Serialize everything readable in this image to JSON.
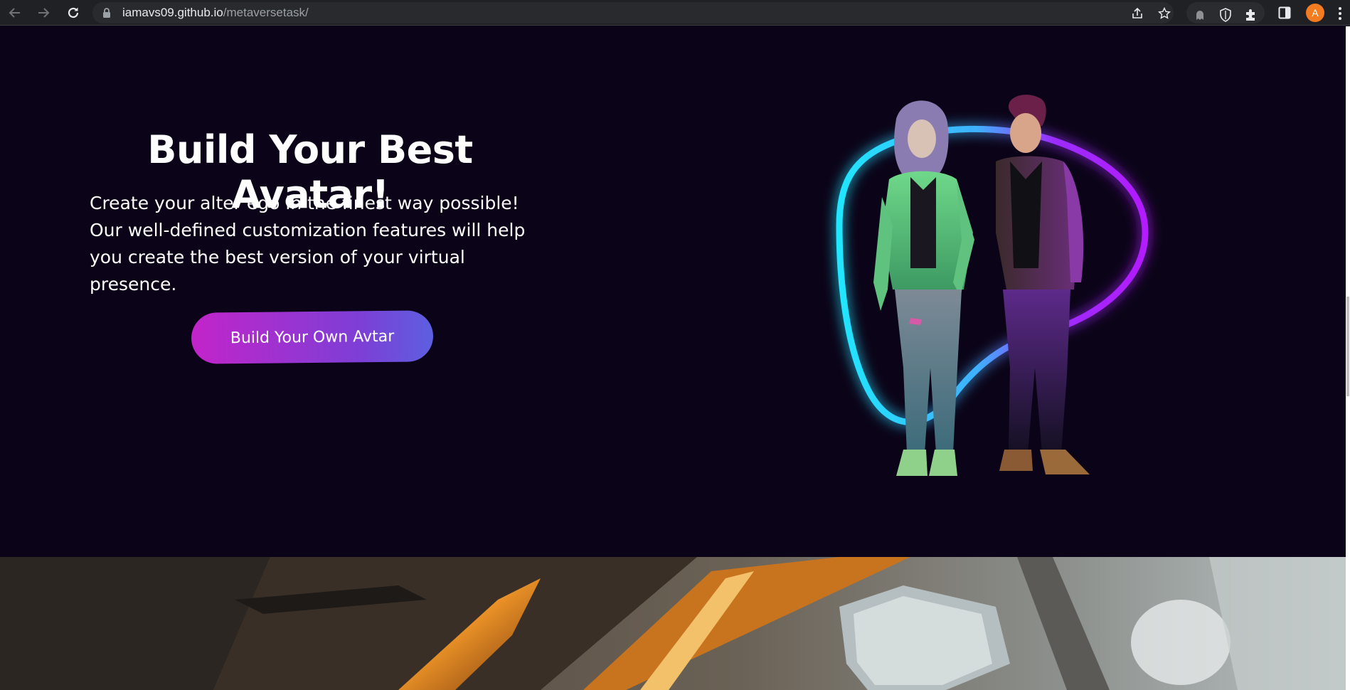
{
  "browser": {
    "url_host": "iamavs09.github.io",
    "url_path": "/metaversetask/",
    "profile_initial": "A",
    "icons": {
      "back": "arrow-left-icon",
      "forward": "arrow-right-icon",
      "reload": "reload-icon",
      "lock": "lock-icon",
      "share": "share-icon",
      "bookmark": "star-icon",
      "extension_1": "ghost-extension-icon",
      "extension_2": "shield-icon",
      "extensions": "puzzle-icon",
      "side_panel": "side-panel-icon",
      "menu": "kebab-menu-icon"
    }
  },
  "hero": {
    "title": "Build Your Best Avatar!",
    "description": "Create your alter ego in the finest way possible! Our well-defined customization features will help you create the best version of your virtual presence.",
    "cta_label": "Build Your Own Avtar"
  },
  "colors": {
    "page_background": "#0b0418",
    "cta_gradient_start": "#c224c9",
    "cta_gradient_end": "#5d5fe0",
    "neon_cyan": "#22e6ff",
    "neon_purple": "#b21cff",
    "profile_badge": "#f27c1f"
  }
}
